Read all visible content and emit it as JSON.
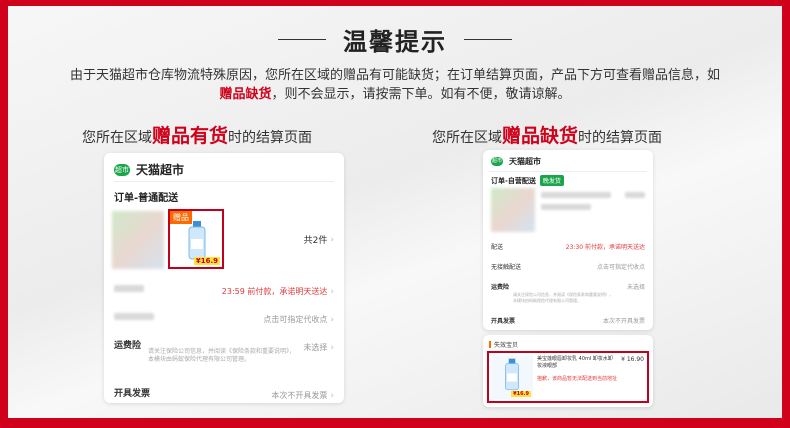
{
  "header": {
    "title": "温馨提示"
  },
  "notice": {
    "part1": "由于天猫超市仓库物流特殊原因，您所在区域的赠品有可能缺货；在订单结算页面，产品下方可查看赠品信息，如",
    "highlight": "赠品缺货",
    "part2": "，则不会显示，请按需下单。如有不便，敬请谅解。"
  },
  "captions": {
    "left": {
      "pre": "您所在区域",
      "big": "赠品有货",
      "post": "时的结算页面"
    },
    "right": {
      "pre": "您所在区域",
      "big": "赠品缺货",
      "post": "时的结算页面"
    }
  },
  "left_phone": {
    "logo_text": "超市",
    "store": "天猫超市",
    "order_title": "订单-普通配送",
    "gift_tag": "赠品",
    "gift_price": "¥16.9",
    "count": "共2件",
    "delivery": "23:59 前付款，承诺明天送达",
    "pickup": "点击可指定代收点",
    "insurance_label": "运费险",
    "insurance_value": "未选择",
    "insurance_note": "请关注保险公司信息，并阅读《保险条款和重要说明》，本模块由蚂蚁保险代理有限公司管理。",
    "invoice_label": "开具发票",
    "invoice_value": "本次不开具发票"
  },
  "right_phone": {
    "logo_text": "超市",
    "store": "天猫超市",
    "order_title": "订单-自营配送",
    "green_chip": "晚发货",
    "delivery_label": "配送",
    "delivery_value": "23:30 前付款，承诺明天送达",
    "pickup_label": "无接触配送",
    "pickup_value": "点击可指定代收点",
    "insurance_label": "运费险",
    "insurance_value": "未选择",
    "insurance_note": "请关注保险公司信息，并阅读《保险条款和重要说明》，本模块由蚂蚁保险代理有限公司管理。",
    "invoice_label": "开具发票",
    "invoice_value": "本次不开具发票"
  },
  "failed_panel": {
    "title": "失效宝贝",
    "item_name": "美宝莲眼唇卸妆乳 40ml 卸妆水卸妆液眼部",
    "item_price": "¥ 16.90",
    "warning": "抱歉，该商品暂无法配送到当前地址",
    "price_chip": "¥16.9"
  },
  "colors": {
    "frame": "#d0021b",
    "accent": "#e4393c",
    "green": "#19a64a"
  }
}
